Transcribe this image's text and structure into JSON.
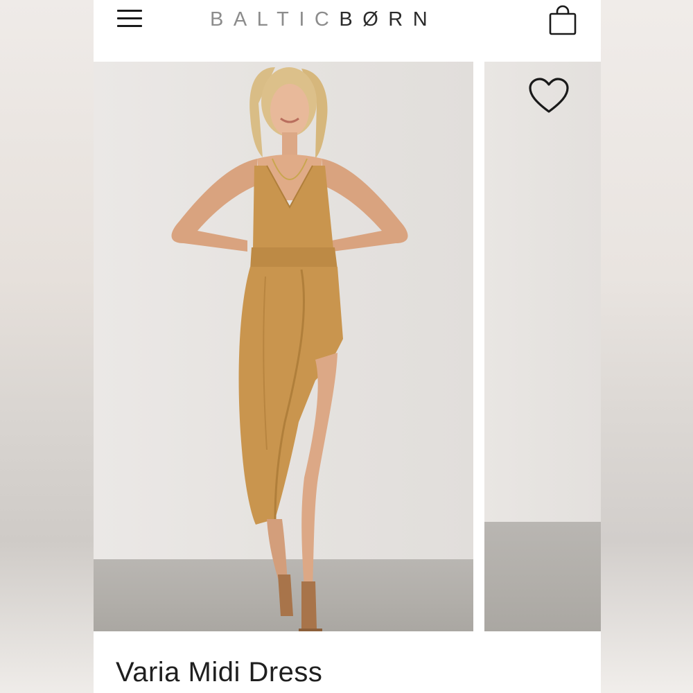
{
  "header": {
    "brand_light": "BALTIC",
    "brand_dark": "BØRN",
    "menu_icon": "hamburger-menu-icon",
    "bag_icon": "shopping-bag-icon"
  },
  "gallery": {
    "favorite_icon": "heart-icon",
    "main_image_description": "photo",
    "dress_color": "#c9954e"
  },
  "product": {
    "title": "Varia Midi Dress"
  }
}
